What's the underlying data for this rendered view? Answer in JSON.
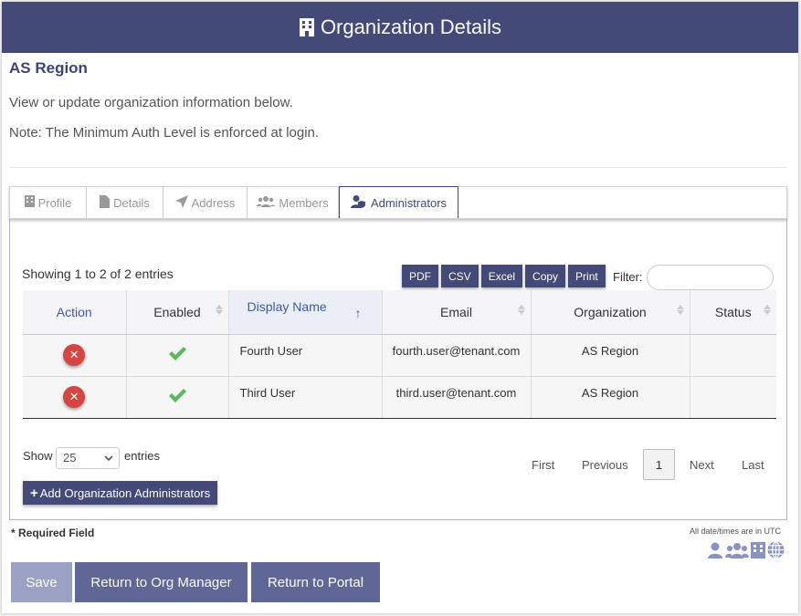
{
  "header": {
    "title": "Organization Details",
    "icon": "building-icon"
  },
  "org_name": "AS Region",
  "intro": "View or update organization information below.",
  "note": "Note: The Minimum Auth Level is enforced at login.",
  "tabs": [
    {
      "label": "Profile",
      "icon": "building-icon"
    },
    {
      "label": "Details",
      "icon": "file-icon"
    },
    {
      "label": "Address",
      "icon": "location-arrow-icon"
    },
    {
      "label": "Members",
      "icon": "users-icon"
    },
    {
      "label": "Administrators",
      "icon": "user-shield-icon",
      "active": true
    }
  ],
  "table_info": "Showing 1 to 2 of 2 entries",
  "export_buttons": [
    "PDF",
    "CSV",
    "Excel",
    "Copy",
    "Print"
  ],
  "filter": {
    "label": "Filter:",
    "value": ""
  },
  "columns": [
    "Action",
    "Enabled",
    "Display Name",
    "Email",
    "Organization",
    "Status"
  ],
  "rows": [
    {
      "enabled": true,
      "display_name": "Fourth User",
      "email": "fourth.user@tenant.com",
      "organization": "AS Region",
      "status": ""
    },
    {
      "enabled": true,
      "display_name": "Third User",
      "email": "third.user@tenant.com",
      "organization": "AS Region",
      "status": ""
    }
  ],
  "length": {
    "show_label": "Show",
    "value": "25",
    "entries_label": "entries"
  },
  "pagination": {
    "first": "First",
    "previous": "Previous",
    "current": "1",
    "next": "Next",
    "last": "Last"
  },
  "add_button": "Add Organization Administrators",
  "required_note": "* Required Field",
  "utc_note": "All date/times are in UTC",
  "footer": {
    "save": "Save",
    "return_org": "Return to Org Manager",
    "return_portal": "Return to Portal"
  },
  "colors": {
    "primary": "#434a78",
    "danger": "#d64541",
    "success": "#5cb85c"
  }
}
